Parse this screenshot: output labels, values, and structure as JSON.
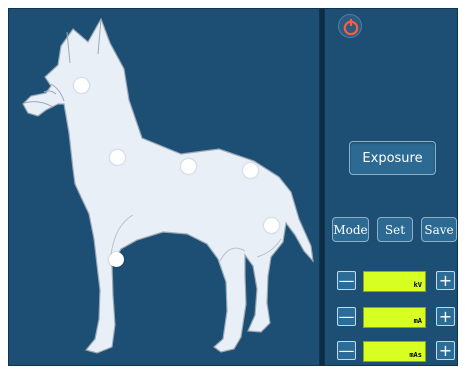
{
  "toolbar": {
    "power_icon": "power-icon",
    "accent_color": "#1c4f73",
    "button_color": "#2c6a93"
  },
  "actions": {
    "exposure": "Exposure",
    "mode": "Mode",
    "set": "Set",
    "save": "Save"
  },
  "controls": [
    {
      "unit": "kV",
      "minus_label": "—",
      "plus_label": "+"
    },
    {
      "unit": "mA",
      "minus_label": "—",
      "plus_label": "+"
    },
    {
      "unit": "mAs",
      "minus_label": "—",
      "plus_label": "+"
    }
  ],
  "anatomy": {
    "hotspots": [
      "head",
      "shoulder",
      "mid-back",
      "hip",
      "rear-leg",
      "front-leg"
    ]
  }
}
